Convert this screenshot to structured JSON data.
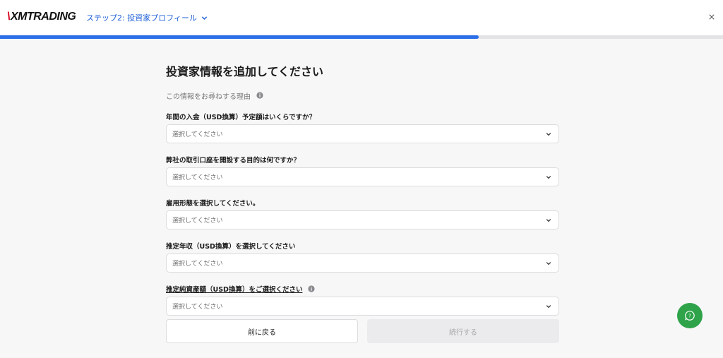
{
  "header": {
    "logo_mark": "\\",
    "logo_text": "XMTRADING",
    "step_label": "ステップ2: 投資家プロフィール"
  },
  "progress": {
    "fraction": 0.662
  },
  "main": {
    "title": "投資家情報を追加してください",
    "why_text": "この情報をお尋ねする理由",
    "questions": [
      {
        "label": "年間の入金（USD換算）予定額はいくらですか？",
        "placeholder": "選択してください"
      },
      {
        "label": "弊社の取引口座を開設する目的は何ですか？",
        "placeholder": "選択してください"
      },
      {
        "label": "雇用形態を選択してください。",
        "placeholder": "選択してください"
      },
      {
        "label": "推定年収（USD換算）を選択してください",
        "placeholder": "選択してください"
      },
      {
        "label": "推定純資産額（USD換算）をご選択ください",
        "placeholder": "選択してください"
      }
    ]
  },
  "buttons": {
    "back": "前に戻る",
    "next": "続行する"
  },
  "colors": {
    "accent": "#2b6ee8",
    "brand_red": "#d6001c",
    "chat_green": "#2fa34a"
  }
}
